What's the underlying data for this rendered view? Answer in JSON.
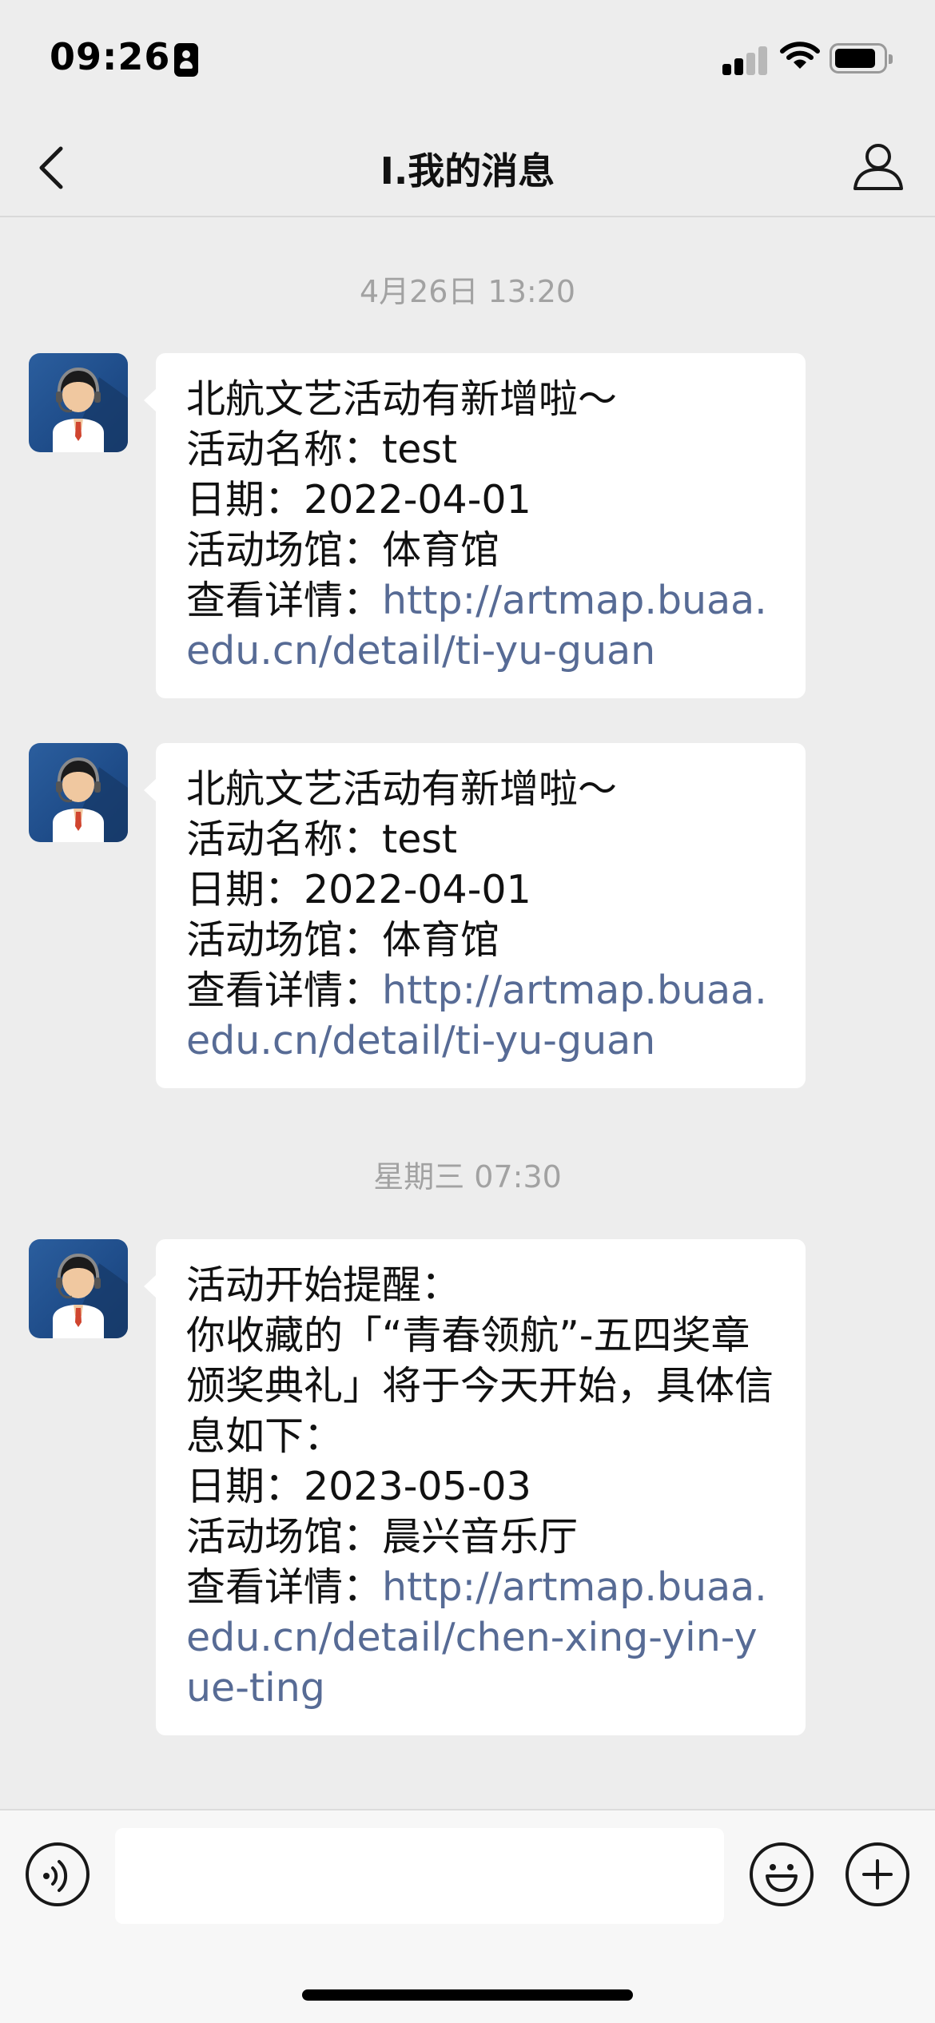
{
  "status_bar": {
    "time": "09:26",
    "signal_bars_filled": 2,
    "signal_bars_total": 4,
    "battery_level_fraction": 0.75
  },
  "nav": {
    "title": "I.我的消息",
    "back_icon": "chevron-left-icon",
    "profile_icon": "person-icon"
  },
  "messages": {
    "group1": {
      "timestamp": "4月26日 13:20"
    },
    "group2": {
      "timestamp": "星期三 07:30"
    },
    "m1": {
      "line1": "北航文艺活动有新增啦～",
      "line2": "活动名称：test",
      "line3": "日期：2022-04-01",
      "line4": "活动场馆：体育馆",
      "detail_label": "查看详情：",
      "link": "http://artmap.buaa.edu.cn/detail/ti-yu-guan"
    },
    "m2": {
      "line1": "北航文艺活动有新增啦～",
      "line2": "活动名称：test",
      "line3": "日期：2022-04-01",
      "line4": "活动场馆：体育馆",
      "detail_label": "查看详情：",
      "link": "http://artmap.buaa.edu.cn/detail/ti-yu-guan"
    },
    "m3": {
      "line1": "活动开始提醒：",
      "line2": "你收藏的「“青春领航”-五四奖章颁奖典礼」将于今天开始，具体信息如下：",
      "line3": "日期：2023-05-03",
      "line4": "活动场馆：晨兴音乐厅",
      "detail_label": "查看详情：",
      "link": "http://artmap.buaa.edu.cn/detail/chen-xing-yin-yue-ting"
    }
  },
  "input_bar": {
    "voice_icon": "voice-icon",
    "message_value": "",
    "emoji_icon": "smiley-icon",
    "plus_icon": "plus-icon"
  },
  "colors": {
    "background": "#ededed",
    "bubble": "#ffffff",
    "link": "#576b95",
    "timestamp": "#a2a2a2",
    "avatar_bg": "#1f4d8a"
  }
}
